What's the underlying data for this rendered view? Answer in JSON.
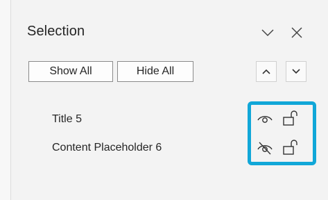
{
  "pane": {
    "title": "Selection"
  },
  "toolbar": {
    "show_all_label": "Show All",
    "hide_all_label": "Hide All"
  },
  "items": [
    {
      "label": "Title 5",
      "visible": true,
      "locked": false,
      "eye_icon": "eye-icon",
      "lock_icon": "unlock-icon"
    },
    {
      "label": "Content Placeholder 6",
      "visible": false,
      "locked": false,
      "eye_icon": "eye-slash-icon",
      "lock_icon": "unlock-icon"
    }
  ],
  "colors": {
    "highlight": "#11a7d8",
    "text": "#252525",
    "background": "#f3f3f3"
  }
}
